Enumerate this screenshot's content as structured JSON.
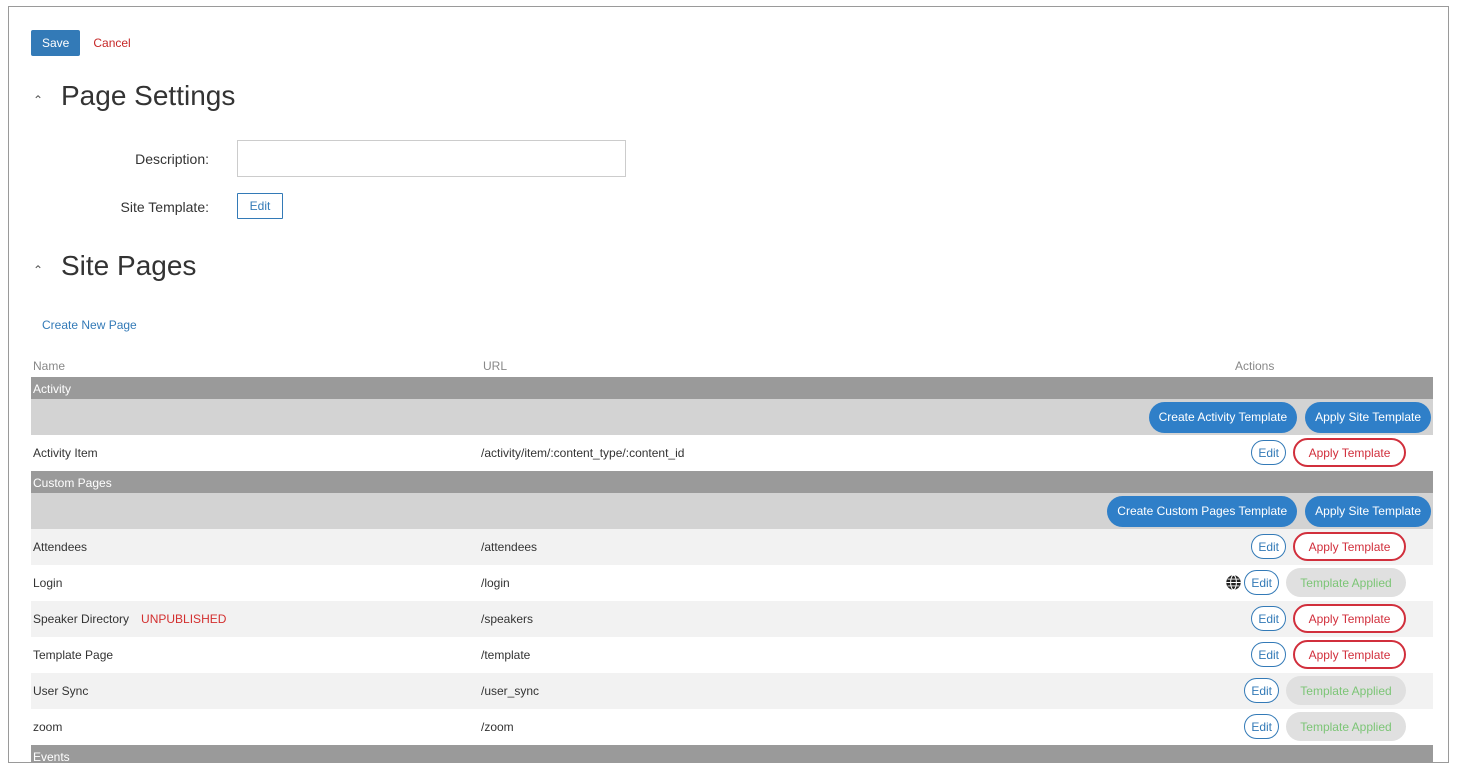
{
  "toolbar": {
    "save_label": "Save",
    "cancel_label": "Cancel"
  },
  "page_settings": {
    "title": "Page Settings",
    "description_label": "Description:",
    "description_value": "",
    "site_template_label": "Site Template:",
    "site_template_edit": "Edit"
  },
  "site_pages": {
    "title": "Site Pages",
    "create_link": "Create New Page",
    "columns": {
      "name": "Name",
      "url": "URL",
      "actions": "Actions"
    },
    "groups": [
      {
        "label": "Activity",
        "create_template_label": "Create Activity Template",
        "apply_site_template_label": "Apply Site Template"
      },
      {
        "label": "Custom Pages",
        "create_template_label": "Create Custom Pages Template",
        "apply_site_template_label": "Apply Site Template"
      },
      {
        "label": "Events"
      }
    ],
    "rows": [
      {
        "name": "Activity Item",
        "url": "/activity/item/:content_type/:content_id",
        "edit": "Edit",
        "template": "Apply Template"
      },
      {
        "name": "Attendees",
        "url": "/attendees",
        "edit": "Edit",
        "template": "Apply Template"
      },
      {
        "name": "Login",
        "url": "/login",
        "edit": "Edit",
        "template": "Template Applied"
      },
      {
        "name": "Speaker Directory",
        "status": "UNPUBLISHED",
        "url": "/speakers",
        "edit": "Edit",
        "template": "Apply Template"
      },
      {
        "name": "Template Page",
        "url": "/template",
        "edit": "Edit",
        "template": "Apply Template"
      },
      {
        "name": "User Sync",
        "url": "/user_sync",
        "edit": "Edit",
        "template": "Template Applied"
      },
      {
        "name": "zoom",
        "url": "/zoom",
        "edit": "Edit",
        "template": "Template Applied"
      }
    ]
  },
  "colors": {
    "primary": "#337ab7",
    "danger": "#d12f3c",
    "success": "#7cc576",
    "group_header": "#9a9a9a"
  },
  "icons": {
    "collapse": "caret-up-icon",
    "globe": "globe-icon"
  }
}
